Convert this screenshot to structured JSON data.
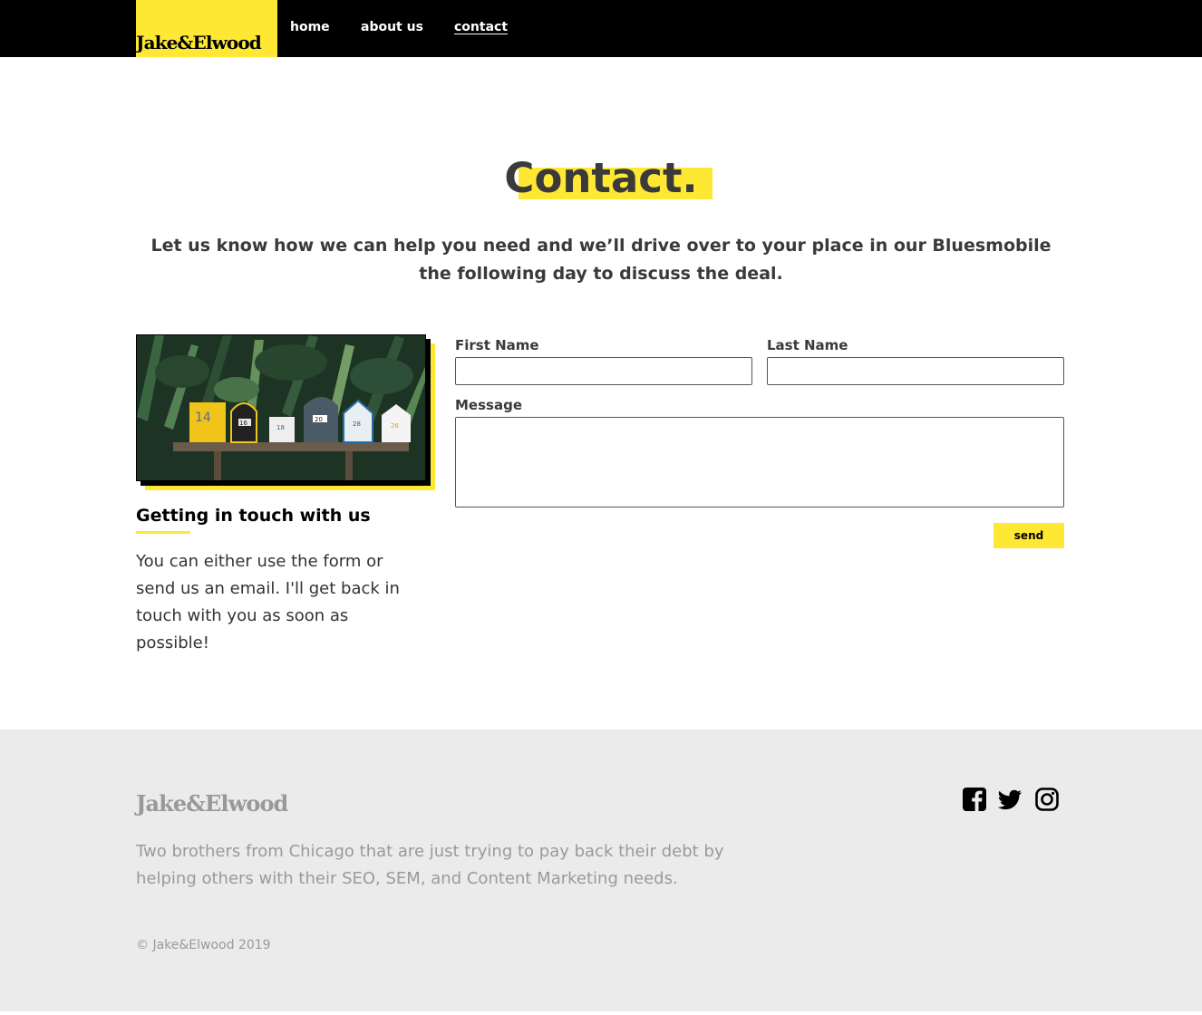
{
  "header": {
    "logo": "Jake&Elwood",
    "nav": [
      {
        "label": "home"
      },
      {
        "label": "about us"
      },
      {
        "label": "contact"
      }
    ]
  },
  "hero": {
    "title": "Contact.",
    "intro": "Let us know how we can help you need and we’ll drive over to your place in our Bluesmobile the following day to discuss the deal."
  },
  "side": {
    "heading": "Getting in touch with us",
    "text": "You can either use the form or send us an email. I'll get back in touch with you as soon as possible!",
    "mailbox_numbers": [
      "14",
      "16",
      "18",
      "20",
      "28",
      "26"
    ]
  },
  "form": {
    "first_name_label": "First Name",
    "last_name_label": "Last Name",
    "message_label": "Message",
    "first_name_value": "",
    "last_name_value": "",
    "message_value": "",
    "send_label": "send"
  },
  "footer": {
    "logo": "Jake&Elwood",
    "description": "Two brothers from Chicago that are just trying to pay back their debt by helping others with their SEO, SEM, and Content Marketing needs.",
    "copyright": "© Jake&Elwood 2019",
    "social": [
      "facebook-icon",
      "twitter-icon",
      "instagram-icon"
    ]
  },
  "colors": {
    "accent": "#ffe834",
    "header_bg": "#000000",
    "footer_bg": "#ebebeb",
    "text_dark": "#3a3a3a",
    "text_muted": "#9a9a9a"
  }
}
